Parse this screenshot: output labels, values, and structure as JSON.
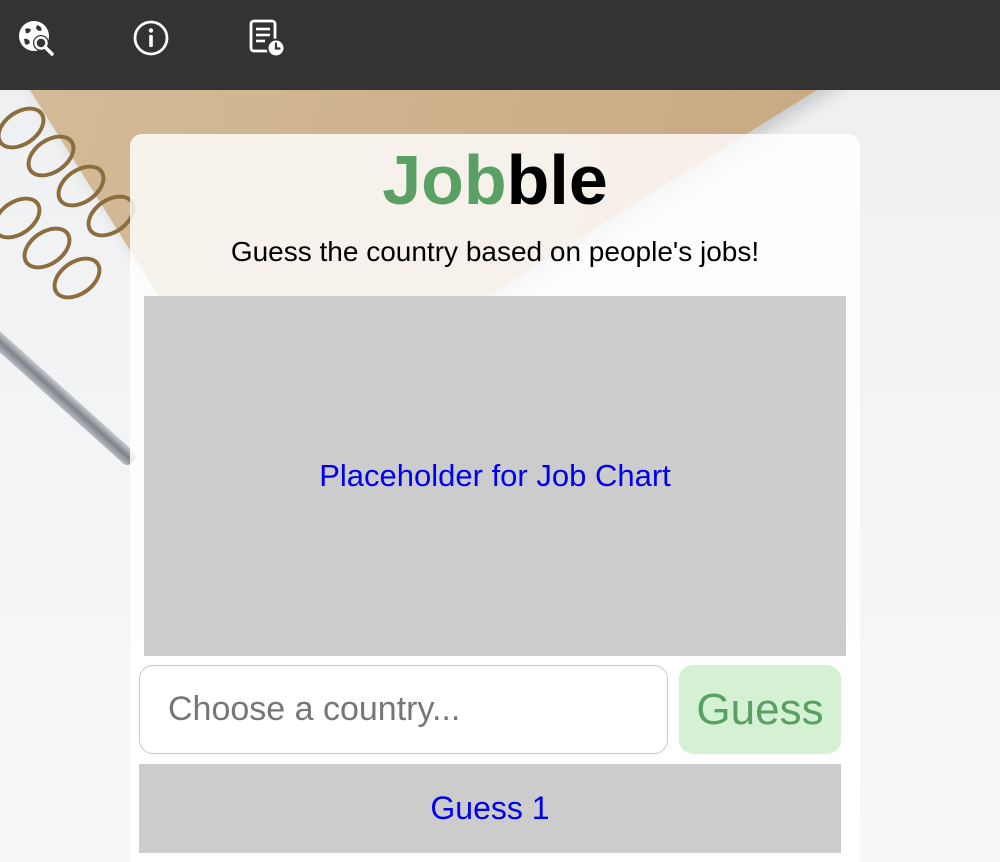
{
  "nav": {
    "icons": [
      "globe-search-icon",
      "info-icon",
      "history-list-icon"
    ]
  },
  "header": {
    "title_part1": "Job",
    "title_part2": "ble",
    "subtitle": "Guess the country based on people's jobs!"
  },
  "chart": {
    "placeholder": "Placeholder for Job Chart"
  },
  "guess_form": {
    "input_placeholder": "Choose a country...",
    "input_value": "",
    "button_label": "Guess"
  },
  "guesses": [
    {
      "label": "Guess 1"
    }
  ],
  "colors": {
    "topbar": "#333333",
    "brand_green": "#5aa064",
    "button_bg": "#d4f1d4",
    "placeholder_bg": "#cccccc",
    "link_blue": "#0000ee"
  }
}
